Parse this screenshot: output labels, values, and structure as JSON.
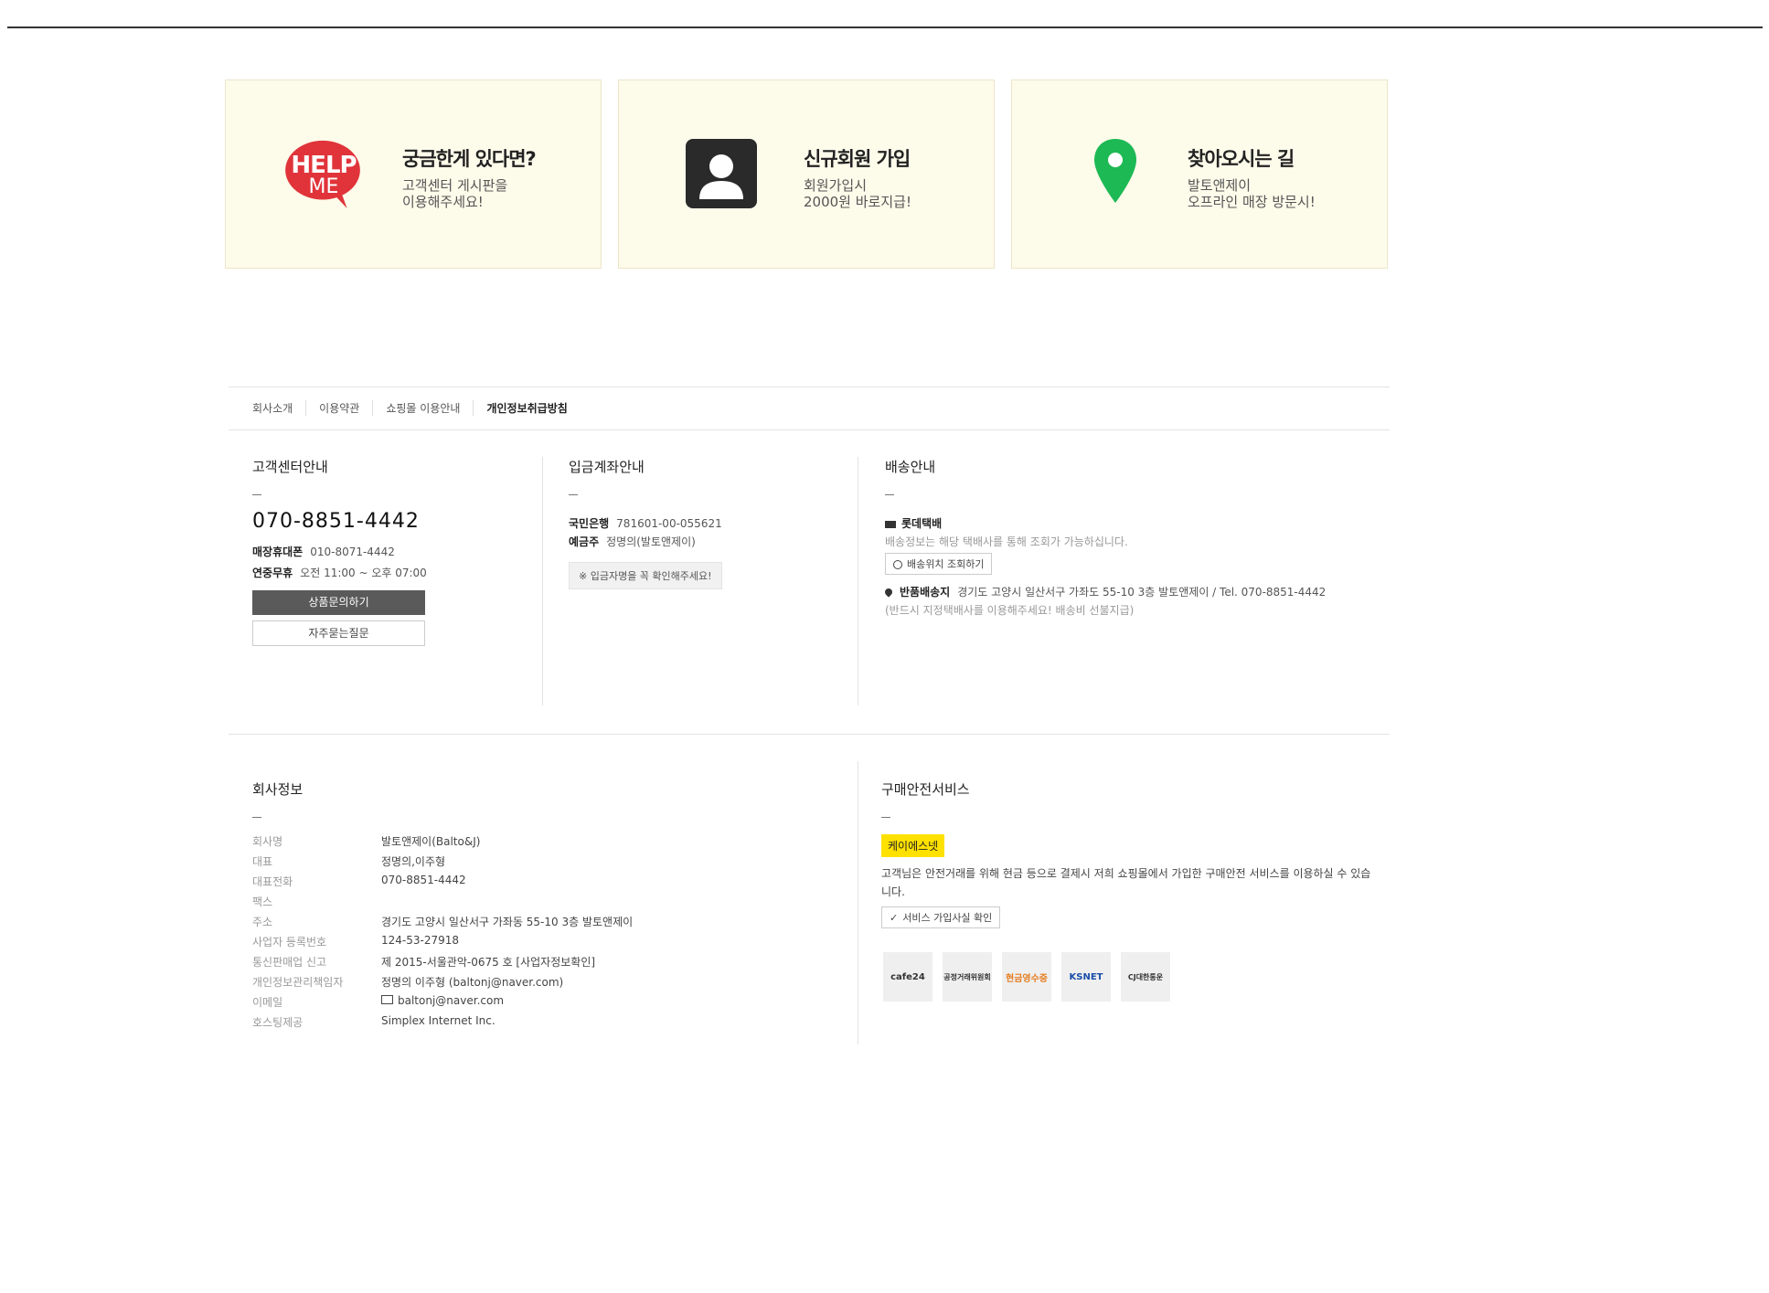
{
  "promos": [
    {
      "title": "궁금한게 있다면?",
      "line1": "고객센터 게시판을",
      "line2": "이용해주세요!",
      "icon": "help-me-bubble-icon",
      "icon_text1": "HELP",
      "icon_text2": "ME"
    },
    {
      "title": "신규회원 가입",
      "line1": "회원가입시",
      "line2": "2000원 바로지급!",
      "icon": "user-card-icon"
    },
    {
      "title": "찾아오시는 길",
      "line1": "발토앤제이",
      "line2": "오프라인 매장 방문시!",
      "icon": "map-pin-icon"
    }
  ],
  "footer_nav": [
    "회사소개",
    "이용약관",
    "쇼핑몰 이용안내",
    "개인정보취급방침"
  ],
  "cs": {
    "title": "고객센터안내",
    "phone": "070-8851-4442",
    "mobile_label": "매장휴대폰",
    "mobile": "010-8071-4442",
    "hours_label": "연중무휴",
    "hours": "오전 11:00 ~ 오후 07:00",
    "inquiry_btn": "상품문의하기",
    "faq_btn": "자주묻는질문"
  },
  "bank": {
    "title": "입금계좌안내",
    "bank_name": "국민은행",
    "account": "781601-00-055621",
    "holder_label": "예금주",
    "holder": "정명의(발토앤제이)",
    "notice": "※ 입금자명을 꼭 확인해주세요!"
  },
  "shipping": {
    "title": "배송안내",
    "courier": "롯데택배",
    "courier_note": "배송정보는 해당 택배사를 통해 조회가 가능하십니다.",
    "track_btn": "배송위치 조회하기",
    "return_label": "반품배송지",
    "return_addr": "경기도 고양시 일산서구 가좌도 55-10 3층 발토앤제이 / Tel. 070-8851-4442",
    "return_note": "(반드시 지정택배사를 이용해주세요! 배송비 선불지급)"
  },
  "company": {
    "title": "회사정보",
    "rows": [
      {
        "k": "회사명",
        "v": "발토앤제이(Balto&J)"
      },
      {
        "k": "대표",
        "v": "정명의,이주형"
      },
      {
        "k": "대표전화",
        "v": "070-8851-4442"
      },
      {
        "k": "팩스",
        "v": ""
      },
      {
        "k": "주소",
        "v": "경기도 고양시 일산서구 가좌동 55-10 3층 발토앤제이"
      },
      {
        "k": "사업자 등록번호",
        "v": "124-53-27918"
      },
      {
        "k": "통신판매업 신고",
        "v": "제 2015-서울관악-0675 호  [사업자정보확인]"
      },
      {
        "k": "개인정보관리책임자",
        "v": "정명의 이주형 (baltonj@naver.com)"
      },
      {
        "k": "이메일",
        "v": "baltonj@naver.com"
      },
      {
        "k": "호스팅제공",
        "v": "Simplex Internet Inc."
      }
    ]
  },
  "safety": {
    "title": "구매안전서비스",
    "badge": "케이에스넷",
    "desc": "고객님은 안전거래를 위해 현금 등으로 결제시 저희 쇼핑몰에서 가입한 구매안전 서비스를 이용하실 수 있습니다.",
    "check_btn": "서비스 가입사실 확인"
  },
  "logos": [
    {
      "name": "cafe24-logo",
      "text": "cafe24"
    },
    {
      "name": "ftc-logo",
      "text": "공정거래위원회"
    },
    {
      "name": "cash-receipt-logo",
      "text": "현금영수증"
    },
    {
      "name": "ksnet-logo",
      "text": "KSNET"
    },
    {
      "name": "cj-logo",
      "text": "CJ대한통운"
    }
  ]
}
